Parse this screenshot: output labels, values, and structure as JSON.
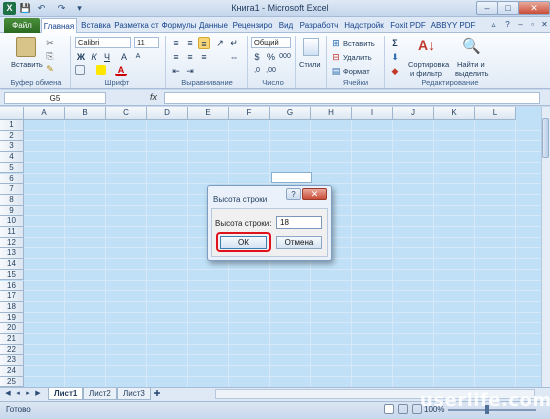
{
  "window": {
    "title": "Книга1  -  Microsoft Excel",
    "minimize": "–",
    "maximize": "□",
    "close": "✕"
  },
  "qat": [
    "save-icon",
    "undo-icon",
    "redo-icon",
    "customize-icon"
  ],
  "tabs": {
    "file": "Файл",
    "items": [
      "Главная",
      "Вставка",
      "Разметка ст",
      "Формулы",
      "Данные",
      "Рецензиро",
      "Вид",
      "Разработч",
      "Надстройк",
      "Foxit PDF",
      "ABBYY PDF"
    ]
  },
  "ribbon": {
    "clipboard": {
      "paste": "Вставить",
      "label": "Буфер обмена"
    },
    "font": {
      "name": "Calibri",
      "size": "11",
      "bold": "Ж",
      "italic": "К",
      "underline": "Ч",
      "label": "Шрифт"
    },
    "alignment": {
      "label": "Выравнивание"
    },
    "number": {
      "format": "Общий",
      "label": "Число"
    },
    "styles": {
      "styles_btn": "Стили",
      "label": ""
    },
    "cells": {
      "insert": "Вставить",
      "delete": "Удалить",
      "format": "Формат",
      "label": "Ячейки"
    },
    "editing": {
      "sort": "Сортировка",
      "sort2": "и фильтр",
      "find": "Найти и",
      "find2": "выделить",
      "label": "Редактирование"
    }
  },
  "formula_bar": {
    "name_box": "G5",
    "fx": "fx",
    "value": ""
  },
  "columns": [
    "A",
    "B",
    "C",
    "D",
    "E",
    "F",
    "G",
    "H",
    "I",
    "J",
    "K",
    "L"
  ],
  "rows": [
    "1",
    "2",
    "3",
    "4",
    "5",
    "6",
    "7",
    "8",
    "9",
    "10",
    "11",
    "12",
    "13",
    "14",
    "15",
    "16",
    "17",
    "18",
    "19",
    "20",
    "21",
    "22",
    "23",
    "24",
    "25"
  ],
  "sheets": [
    "Лист1",
    "Лист2",
    "Лист3"
  ],
  "status": {
    "text": "Готово",
    "zoom": "100%",
    "watermark": "userlife.com"
  },
  "dialog": {
    "title": "Высота строки",
    "help": "?",
    "close": "✕",
    "label": "Высота строки:",
    "value": "18",
    "ok": "ОК",
    "cancel": "Отмена"
  }
}
